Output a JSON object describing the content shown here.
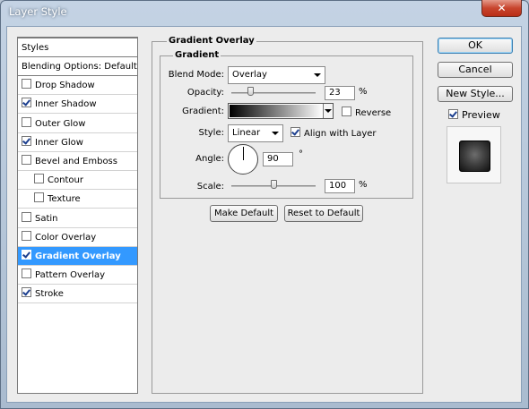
{
  "window": {
    "title": "Layer Style",
    "close_glyph": "✕"
  },
  "sidebar": {
    "header": "Styles",
    "items": [
      {
        "label": "Blending Options: Default",
        "checkbox": false,
        "checked": false,
        "indent": false,
        "selected": false,
        "header": true
      },
      {
        "label": "Drop Shadow",
        "checkbox": true,
        "checked": false,
        "indent": false,
        "selected": false
      },
      {
        "label": "Inner Shadow",
        "checkbox": true,
        "checked": true,
        "indent": false,
        "selected": false
      },
      {
        "label": "Outer Glow",
        "checkbox": true,
        "checked": false,
        "indent": false,
        "selected": false
      },
      {
        "label": "Inner Glow",
        "checkbox": true,
        "checked": true,
        "indent": false,
        "selected": false
      },
      {
        "label": "Bevel and Emboss",
        "checkbox": true,
        "checked": false,
        "indent": false,
        "selected": false
      },
      {
        "label": "Contour",
        "checkbox": true,
        "checked": false,
        "indent": true,
        "selected": false
      },
      {
        "label": "Texture",
        "checkbox": true,
        "checked": false,
        "indent": true,
        "selected": false
      },
      {
        "label": "Satin",
        "checkbox": true,
        "checked": false,
        "indent": false,
        "selected": false
      },
      {
        "label": "Color Overlay",
        "checkbox": true,
        "checked": false,
        "indent": false,
        "selected": false
      },
      {
        "label": "Gradient Overlay",
        "checkbox": true,
        "checked": true,
        "indent": false,
        "selected": true
      },
      {
        "label": "Pattern Overlay",
        "checkbox": true,
        "checked": false,
        "indent": false,
        "selected": false
      },
      {
        "label": "Stroke",
        "checkbox": true,
        "checked": true,
        "indent": false,
        "selected": false
      }
    ]
  },
  "panel": {
    "section_title": "Gradient Overlay",
    "group_title": "Gradient",
    "blend_mode": {
      "label": "Blend Mode:",
      "value": "Overlay"
    },
    "opacity": {
      "label": "Opacity:",
      "value": "23",
      "unit": "%",
      "fraction": 0.23
    },
    "gradient": {
      "label": "Gradient:",
      "reverse_label": "Reverse",
      "reverse_checked": false
    },
    "style": {
      "label": "Style:",
      "value": "Linear",
      "align_label": "Align with Layer",
      "align_checked": true
    },
    "angle": {
      "label": "Angle:",
      "value": "90",
      "unit": "°"
    },
    "scale": {
      "label": "Scale:",
      "value": "100",
      "unit": "%",
      "fraction": 0.5
    },
    "make_default": "Make Default",
    "reset_default": "Reset to Default"
  },
  "buttons": {
    "ok": "OK",
    "cancel": "Cancel",
    "new_style": "New Style...",
    "preview_label": "Preview",
    "preview_checked": true
  }
}
